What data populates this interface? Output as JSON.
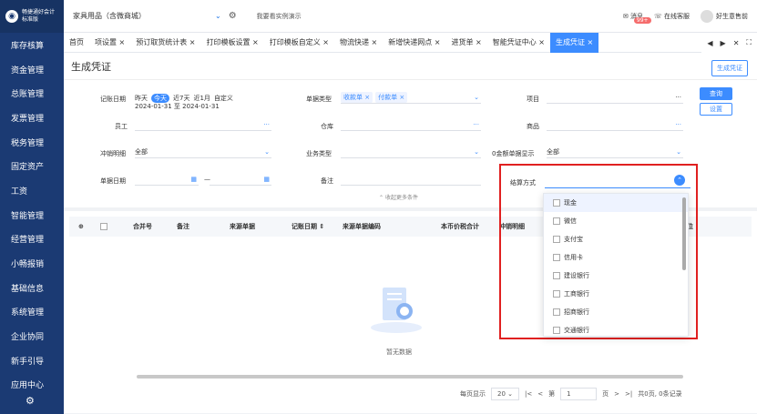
{
  "brand": {
    "name": "畅捷通好会计",
    "edition": "标准版"
  },
  "sidebar": {
    "items": [
      "库存核算",
      "资金管理",
      "总账管理",
      "发票管理",
      "税务管理",
      "固定资产",
      "工资",
      "智能管理",
      "经营管理",
      "小畅报销",
      "基础信息",
      "系统管理",
      "企业协同",
      "新手引导",
      "应用中心"
    ]
  },
  "topbar": {
    "company": "家具用品（含微商城）",
    "demo": "我要看实例演示",
    "msg": "消息",
    "badge": "99+",
    "service": "在线客服",
    "user": "好生意售前"
  },
  "tabs": [
    "首页",
    "项设置 ×",
    "预订取货统计表 ×",
    "打印模板设置 ×",
    "打印模板自定义 ×",
    "物流快递 ×",
    "新增快递网点 ×",
    "进货单 ×",
    "智能凭证中心 ×",
    "生成凭证 ×"
  ],
  "page": {
    "title": "生成凭证",
    "generate": "生成凭证"
  },
  "filter": {
    "date_label": "记账日期",
    "date_opts": [
      "昨天",
      "今天",
      "近7天",
      "近1月",
      "自定义"
    ],
    "date_range": "2024-01-31 至 2024-01-31",
    "doc_type_label": "单据类型",
    "doc_tags": [
      "收款单 ×",
      "付款单 ×"
    ],
    "project_label": "项目",
    "employee_label": "员工",
    "warehouse_label": "仓库",
    "goods_label": "商品",
    "offset_label": "冲销明细",
    "offset_val": "全部",
    "biz_label": "业务类型",
    "zero_label": "0金额单据显示",
    "zero_val": "全部",
    "docdate_label": "单据日期",
    "dash": "—",
    "remark_label": "备注",
    "settle_label": "结算方式",
    "query": "查询",
    "settings": "设置",
    "collapse": "收起更多条件",
    "ellipsis": "···"
  },
  "table": {
    "headers": [
      "合并号",
      "备注",
      "来源单据",
      "记账日期 ⇕",
      "来源单据编码",
      "本币价税合计",
      "冲销明细",
      "位"
    ],
    "empty": "暂无数据"
  },
  "pager": {
    "per_page": "每页显示",
    "size": "20",
    "page_pre": "第",
    "page": "1",
    "page_post": "页",
    "total": "共0页, 0条记录"
  },
  "dropdown": {
    "options": [
      "现金",
      "微信",
      "支付宝",
      "信用卡",
      "建设银行",
      "工商银行",
      "招商银行",
      "交通银行"
    ]
  }
}
